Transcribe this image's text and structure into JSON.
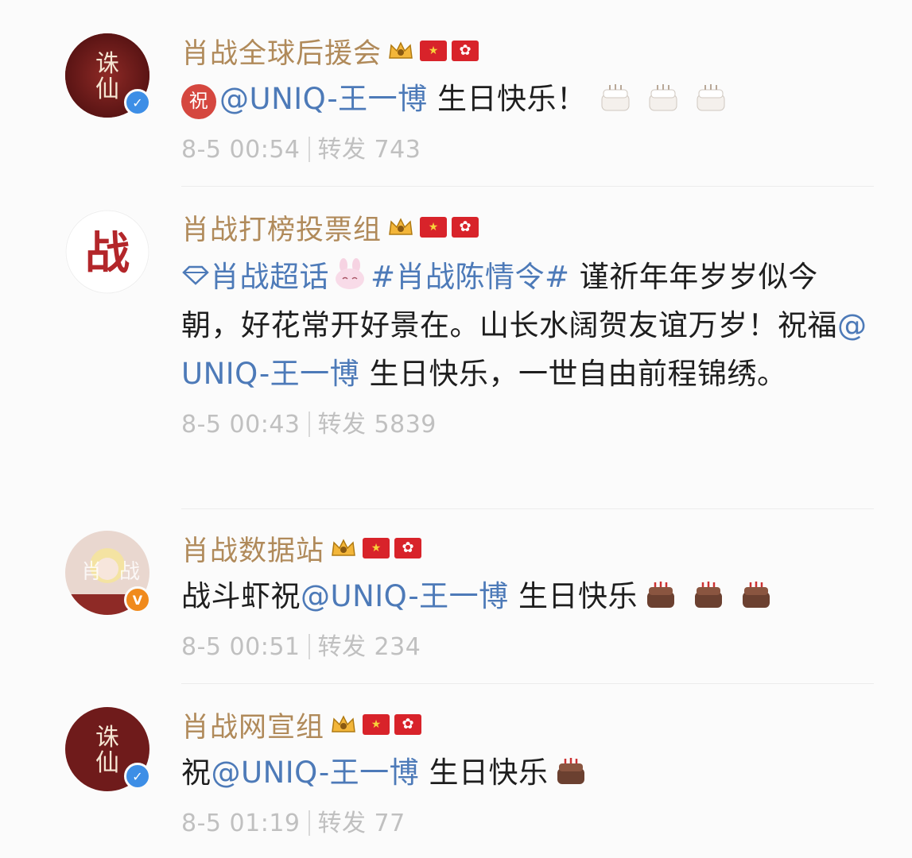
{
  "comments": [
    {
      "username": "肖战全球后援会",
      "prefix_badge": "祝",
      "mention": "@UNIQ-王一博",
      "text": " 生日快乐！",
      "cake_count": 3,
      "date": "8-5 00:54",
      "repost_label": "转发",
      "repost_count": "743",
      "verify": "blue"
    },
    {
      "username": "肖战打榜投票组",
      "supertopic": "肖战超话",
      "hashtag": "#肖战陈情令#",
      "text_before_mention": " 谨祈年年岁岁似今朝，好花常开好景在。山长水阔贺友谊万岁！祝福",
      "mention": "@UNIQ-王一博",
      "text_after_mention": " 生日快乐，一世自由前程锦绣。",
      "date": "8-5 00:43",
      "repost_label": "转发",
      "repost_count": "5839",
      "avatar_char": "战"
    },
    {
      "username": "肖战数据站",
      "text_before_mention": "战斗虾祝",
      "mention": "@UNIQ-王一博",
      "text": " 生日快乐",
      "cake_count": 3,
      "date": "8-5 00:51",
      "repost_label": "转发",
      "repost_count": "234",
      "verify": "orange"
    },
    {
      "username": "肖战网宣组",
      "text_before_mention": "祝",
      "mention": "@UNIQ-王一博",
      "text": " 生日快乐",
      "cake_count": 1,
      "date": "8-5 01:19",
      "repost_label": "转发",
      "repost_count": "77",
      "verify": "blue"
    }
  ],
  "colors": {
    "username": "#b08a5a",
    "mention": "#4d7ab8",
    "meta": "#c0c0c0",
    "verify_blue": "#3d8ee6",
    "verify_orange": "#f08a1c"
  }
}
